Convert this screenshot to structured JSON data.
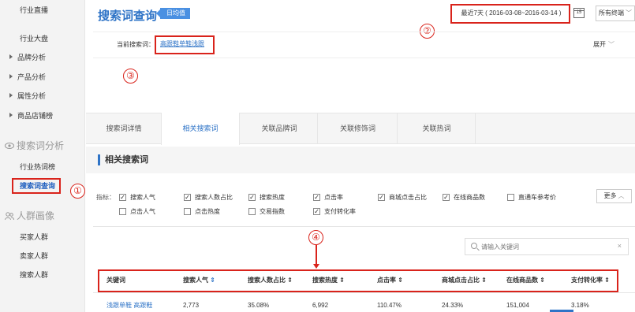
{
  "sidebar": {
    "items": [
      {
        "label": "行业直播",
        "type": "sub"
      },
      {
        "label": "行业大盘",
        "type": "sub"
      },
      {
        "label": "品牌分析",
        "type": "arrow"
      },
      {
        "label": "产品分析",
        "type": "arrow"
      },
      {
        "label": "属性分析",
        "type": "arrow"
      },
      {
        "label": "商品店铺榜",
        "type": "arrow"
      }
    ],
    "section1": "搜索词分析",
    "section1_items": [
      "行业热词榜",
      "搜索词查询"
    ],
    "section2": "人群画像",
    "section2_items": [
      "买家人群",
      "卖家人群",
      "搜索人群"
    ]
  },
  "header": {
    "title": "搜索词查询",
    "badge": "日均值",
    "date_range": "最近7天 ( 2016-03-08~2016-03-14 )",
    "calendar_day": "15",
    "terminal": "所有终端"
  },
  "keyword": {
    "label": "当前搜索词：",
    "value": "高跟鞋单鞋浅跟",
    "expand": "展开"
  },
  "tabs": [
    "搜索词详情",
    "相关搜索词",
    "关联品牌词",
    "关联修饰词",
    "关联热词"
  ],
  "section_title": "相关搜索词",
  "indicators": {
    "label": "指标：",
    "more": "更多",
    "items": [
      {
        "label": "搜索人气",
        "checked": true
      },
      {
        "label": "搜索人数占比",
        "checked": true
      },
      {
        "label": "搜索热度",
        "checked": true
      },
      {
        "label": "点击率",
        "checked": true
      },
      {
        "label": "商城点击占比",
        "checked": true
      },
      {
        "label": "在线商品数",
        "checked": true
      },
      {
        "label": "直通车参考价",
        "checked": false
      },
      {
        "label": "点击人气",
        "checked": false
      },
      {
        "label": "点击热度",
        "checked": false
      },
      {
        "label": "交易指数",
        "checked": false
      },
      {
        "label": "支付转化率",
        "checked": true
      }
    ]
  },
  "search": {
    "placeholder": "请输入关键词",
    "clear": "×"
  },
  "table": {
    "headers": [
      "关键词",
      "搜索人气",
      "搜索人数占比",
      "搜索热度",
      "点击率",
      "商城点击占比",
      "在线商品数",
      "支付转化率"
    ],
    "rows": [
      [
        "浅跟单鞋 高跟鞋",
        "2,773",
        "35.08%",
        "6,992",
        "110.47%",
        "24.33%",
        "151,004",
        "3.18%"
      ]
    ]
  },
  "annotations": [
    "①",
    "②",
    "③",
    "④"
  ],
  "colors": {
    "accent": "#2f74c7",
    "annotation": "#d9231b"
  }
}
